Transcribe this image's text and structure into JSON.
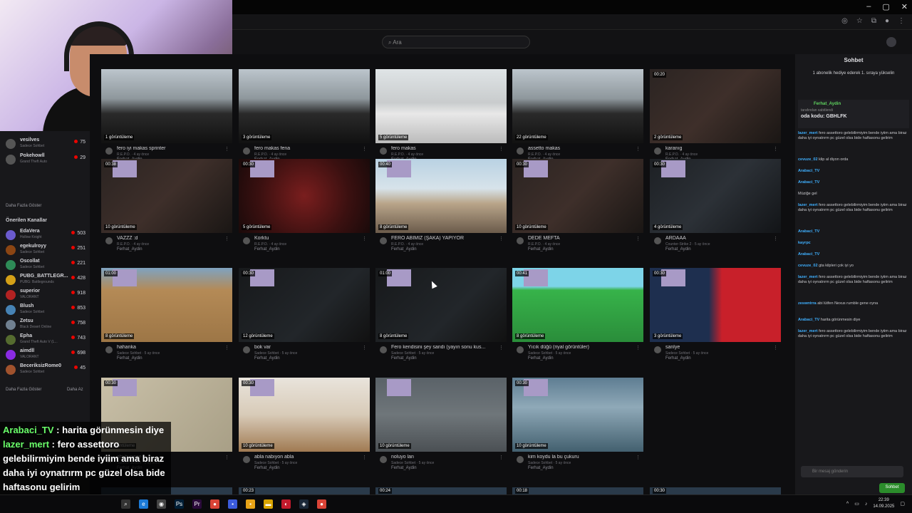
{
  "search": {
    "placeholder": "Ara"
  },
  "chat": {
    "title": "Sohbet",
    "banner": "1 abonelik hediye ederek 1. sıraya yükselin",
    "pinned_user": "Ferhat_Aydin",
    "pinned_label": "tarafından sabitlendi",
    "pinned_text": "oda kodu: GBHLFK",
    "input_placeholder": "Bir mesaj gönderin",
    "send_label": "Sohbet",
    "lines": [
      {
        "user": "lazer_mert",
        "text": "fero assettoro gelebilirmiyim bende iyiim ama biraz daha iyi oynatrırm pc güzel olsa bide haftasonu gelirim"
      },
      {
        "user": "cevuze_02",
        "text": "klip al diyon orda"
      },
      {
        "user": "Arabaci_TV",
        "text": ""
      },
      {
        "user": "Arabaci_TV",
        "text": ""
      },
      {
        "user": "",
        "text": "Müziğe gel"
      },
      {
        "user": "lazer_mert",
        "text": "fero assettoro gelebilirmiyim bende iyiim ama biraz daha iyi oynatrırm pc güzel olsa bide haftasonu gelirim"
      },
      {
        "user": "Arabaci_TV",
        "text": ""
      },
      {
        "user": "kayrpc",
        "text": ""
      },
      {
        "user": "Arabaci_TV",
        "text": ""
      },
      {
        "user": "cevuze_02",
        "text": "gta kilpleri çok iyi yo"
      },
      {
        "user": "lazer_mert",
        "text": "fero assettoro gelebilirmiyim bende iyiim ama biraz daha iyi oynatrırm pc güzel olsa bide haftasonu gelirim"
      },
      {
        "user": "zeswntrra",
        "text": "abi lütfen Nexus rumble gene oyna"
      },
      {
        "user": "Arabaci_TV",
        "text": "harita görünmesin diye"
      },
      {
        "user": "lazer_mert",
        "text": "fero assettoro gelebilirmiyim bende iyiim ama biraz daha iyi oynatrırm pc güzel olsa bide haftasonu gelirim"
      }
    ]
  },
  "sidebar": {
    "top_items": [
      {
        "name": "vesilves",
        "game": "Sadece Sohbet",
        "count": "75"
      },
      {
        "name": "Pokehowll",
        "game": "Grand Theft Auto",
        "count": "29"
      }
    ],
    "more_label": "Daha Fazla Göster",
    "recommended_title": "Önerilen Kanallar",
    "recommended": [
      {
        "name": "EdaVera",
        "game": "Hollow Knight",
        "count": "503"
      },
      {
        "name": "egekulroyy",
        "game": "Sadece Sohbet",
        "count": "251"
      },
      {
        "name": "Oscollat",
        "game": "Sadece Sohbet",
        "count": "221"
      },
      {
        "name": "PUBG_BATTLEGR...",
        "game": "PUBG: Battlegrounds",
        "count": "428"
      },
      {
        "name": "superior",
        "game": "VALORANT",
        "count": "918"
      },
      {
        "name": "Blush",
        "game": "Sadece Sohbet",
        "count": "853"
      },
      {
        "name": "Zetsu",
        "game": "Black Desert Online",
        "count": "758"
      },
      {
        "name": "Epha",
        "game": "Grand Theft Auto V (L...",
        "count": "743"
      },
      {
        "name": "aimdll",
        "game": "VALORANT",
        "count": "698"
      },
      {
        "name": "BeceriksizRome0",
        "game": "Sadece Sohbet",
        "count": "45"
      }
    ],
    "more_label2": "Daha Fazla Göster",
    "less_label": "Daha Az"
  },
  "videos": [
    {
      "title": "fero iyi makas sprinter",
      "sub": "R.E.P.O. · 4 ay önce",
      "author": "Ferhat_Aydin",
      "views": "1 görüntüleme",
      "duration": "",
      "thumb": "drive"
    },
    {
      "title": "fero makas fena",
      "sub": "R.E.P.O. · 4 ay önce",
      "author": "Ferhat_Aydin",
      "views": "3 görüntüleme",
      "duration": "",
      "thumb": "drive"
    },
    {
      "title": "fero makas",
      "sub": "R.E.P.O. · 4 ay önce",
      "author": "Ferhat_Aydin",
      "views": "5 görüntüleme",
      "duration": "",
      "thumb": "drive-white"
    },
    {
      "title": "assetto makas",
      "sub": "R.E.P.O. · 4 ay önce",
      "author": "Ferhat_Aydin",
      "views": "22 görüntüleme",
      "duration": "",
      "thumb": "drive"
    },
    {
      "title": "karanıg",
      "sub": "R.E.P.O. · 4 ay önce",
      "author": "Ferhat_Aydin",
      "views": "2 görüntüleme",
      "duration": "00:20",
      "thumb": "dark"
    },
    {
      "title": "VAZZZ :d",
      "sub": "R.E.P.O. · 4 ay önce",
      "author": "Ferhat_Aydin",
      "views": "10 görüntüleme",
      "duration": "00:38",
      "thumb": "dark"
    },
    {
      "title": "Korktu",
      "sub": "R.E.P.O. · 4 ay önce",
      "author": "Ferhat_Aydin",
      "views": "5 görüntüleme",
      "duration": "00:30",
      "thumb": "red"
    },
    {
      "title": "FERO ABİMİZ (ŞAKA) YAPIYOR",
      "sub": "R.E.P.O. · 4 ay önce",
      "author": "Ferhat_Aydin",
      "views": "8 görüntüleme",
      "duration": "00:40",
      "thumb": "road"
    },
    {
      "title": "DEDE MEFTA",
      "sub": "R.E.P.O. · 4 ay önce",
      "author": "Ferhat_Aydin",
      "views": "10 görüntüleme",
      "duration": "00:30",
      "thumb": "dark"
    },
    {
      "title": "ARDAAA",
      "sub": "Counter-Strike 2 · 5 ay önce",
      "author": "Ferhat_Aydin",
      "views": "4 görüntüleme",
      "duration": "00:30",
      "thumb": "cs"
    },
    {
      "title": "hahanka",
      "sub": "Sadece Sohbet · 5 ay önce",
      "author": "Ferhat_Aydin",
      "views": "8 görüntüleme",
      "duration": "01:00",
      "thumb": "desert"
    },
    {
      "title": "bok var",
      "sub": "Sadece Sohbet · 5 ay önce",
      "author": "Ferhat_Aydin",
      "views": "12 görüntüleme",
      "duration": "00:30",
      "thumb": "dark2"
    },
    {
      "title": "Fero kendisini şey sandı (yayın sonu kus...",
      "sub": "Sadece Sohbet · 5 ay önce",
      "author": "Ferhat_Aydin",
      "views": "8 görüntüleme",
      "duration": "01:00",
      "thumb": "dark2"
    },
    {
      "title": "Yıcık düğü (riyal görüntüler)",
      "sub": "Sadece Sohbet · 5 ay önce",
      "author": "Ferhat_Aydin",
      "views": "8 görüntüleme",
      "duration": "00:41",
      "thumb": "green"
    },
    {
      "title": "sanlye",
      "sub": "Sadece Sohbet · 5 ay önce",
      "author": "Ferhat_Aydin",
      "views": "3 görüntüleme",
      "duration": "00:30",
      "thumb": "orha"
    },
    {
      "title": "abi buneee",
      "sub": "Sadece Sohbet · 5 ay önce",
      "author": "Ferhat_Aydin",
      "views": "11 görüntüleme",
      "duration": "00:30",
      "thumb": "map"
    },
    {
      "title": "abla nabıyon abla",
      "sub": "Sadece Sohbet · 5 ay önce",
      "author": "Ferhat_Aydin",
      "views": "10 görüntüleme",
      "duration": "00:30",
      "thumb": "room"
    },
    {
      "title": "noluyo lan",
      "sub": "Sadece Sohbet · 5 ay önce",
      "author": "Ferhat_Aydin",
      "views": "10 görüntüleme",
      "duration": "",
      "thumb": "car"
    },
    {
      "title": "kim koydu la bu çukuru",
      "sub": "Sadece Sohbet · 5 ay önce",
      "author": "Ferhat_Aydin",
      "views": "10 görüntüleme",
      "duration": "00:30",
      "thumb": "snow"
    }
  ],
  "bottom_row_durations": [
    "",
    "00:23",
    "00:24",
    "00:18",
    "00:30"
  ],
  "overlay": {
    "line1_user": "Arabaci_TV",
    "line1_text": ": harita görünmesin diye",
    "line2_user": "lazer_mert",
    "line2_text": ": fero assettoro gelebilirmiyim bende iyiim ama biraz daha iyi oynatrırm pc güzel olsa bide haftasonu gelirim"
  },
  "taskbar": {
    "time": "22:39",
    "date": "14.09.2025"
  },
  "colors": {
    "accent": "#9147ff",
    "live": "#eb0400",
    "send": "#2b8c2b"
  }
}
